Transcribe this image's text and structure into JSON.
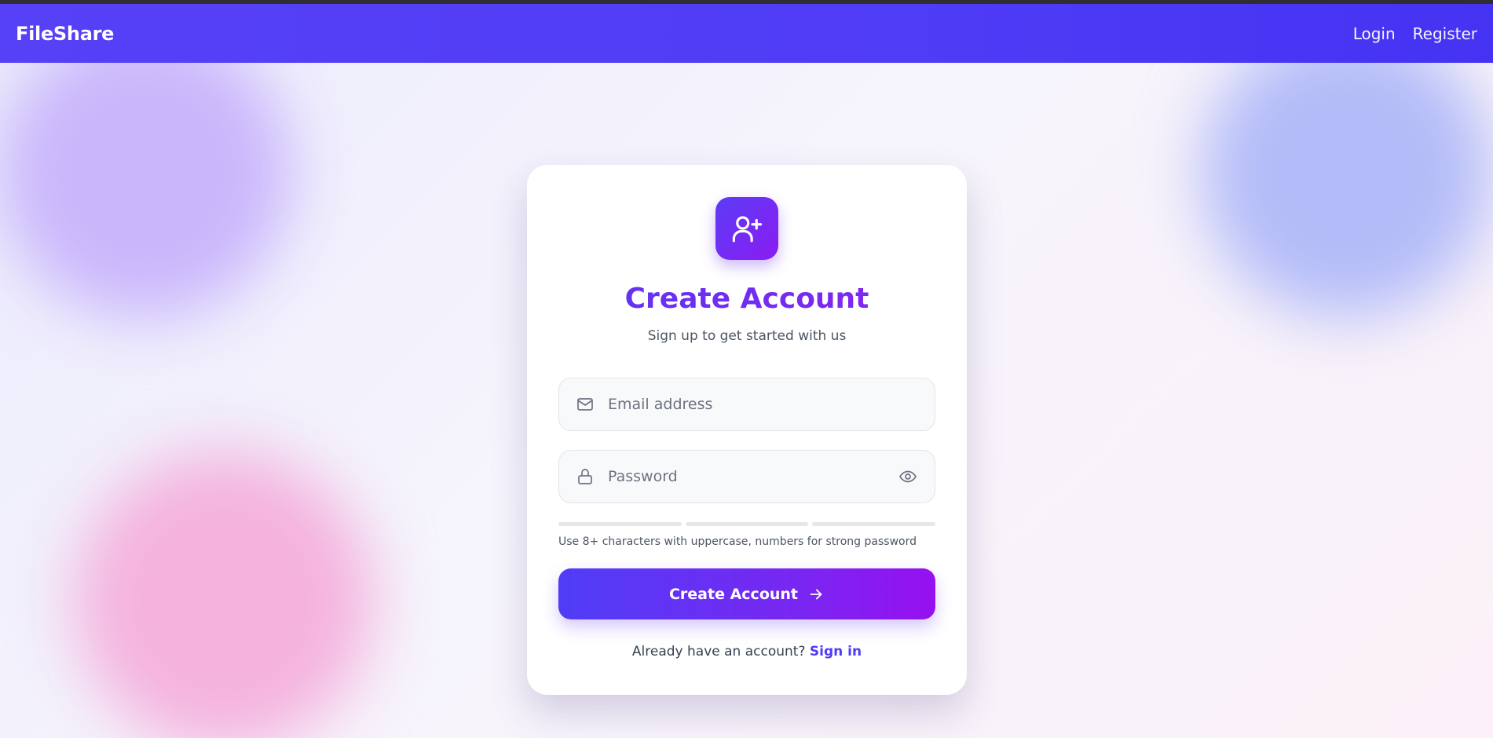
{
  "navbar": {
    "brand": "FileShare",
    "links": [
      {
        "label": "Login"
      },
      {
        "label": "Register"
      }
    ]
  },
  "card": {
    "title": "Create Account",
    "subtitle": "Sign up to get started with us",
    "email": {
      "placeholder": "Email address",
      "value": "",
      "icon": "mail-icon"
    },
    "password": {
      "placeholder": "Password",
      "value": "",
      "icon": "lock-icon",
      "toggle_icon": "eye-icon"
    },
    "strength": {
      "segments": 3,
      "filled": 0
    },
    "hint": "Use 8+ characters with uppercase, numbers for strong password",
    "submit_label": "Create Account",
    "footer_text": "Already have an account?",
    "footer_link": "Sign in"
  },
  "colors": {
    "nav_bg": "#4f3cf6",
    "accent": "#6a2cf2",
    "button_start": "#4f3df6",
    "button_end": "#9710f0",
    "link": "#4f3df6"
  }
}
